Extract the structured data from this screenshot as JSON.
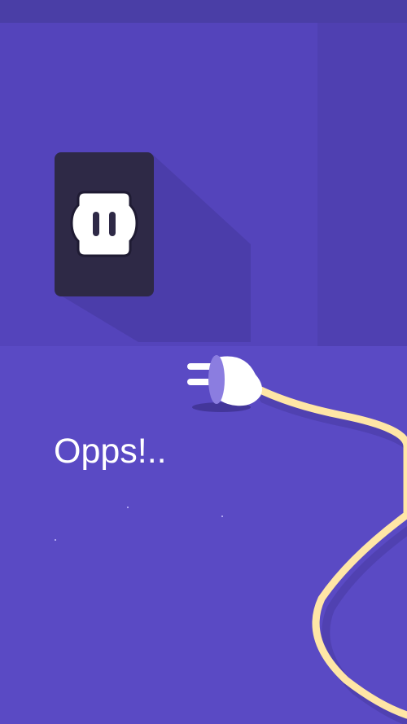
{
  "error": {
    "message": "Opps!.."
  },
  "illustration": {
    "outlet_icon": "power-outlet-icon",
    "plug_icon": "unplugged-plug-icon",
    "cable_icon": "power-cable-icon"
  },
  "colors": {
    "background": "#5a4ac3",
    "wall": "#5444bb",
    "side_wall": "#4f40b1",
    "outlet_plate": "#2e2946",
    "cable": "#ffe6a6",
    "text": "#ffffff"
  }
}
